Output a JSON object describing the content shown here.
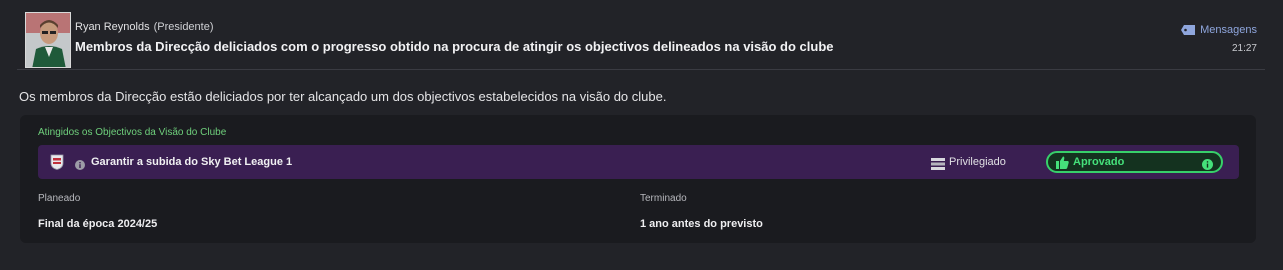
{
  "message": {
    "sender_name": "Ryan Reynolds",
    "sender_role": "(Presidente)",
    "subject": "Membros da Direcção deliciados com o progresso obtido na procura de atingir os objectivos delineados na visão do clube",
    "messages_link": "Mensagens",
    "time": "21:27",
    "body": "Os membros da Direcção estão deliciados por ter alcançado um dos objectivos estabelecidos na visão do clube."
  },
  "panel": {
    "title": "Atingidos os Objectivos da Visão do Clube",
    "objective": {
      "text": "Garantir a subida do Sky Bet League 1",
      "priority": "Privilegiado",
      "status": "Aprovado"
    },
    "planned_label": "Planeado",
    "planned_value": "Final da época 2024/25",
    "finished_label": "Terminado",
    "finished_value": "1 ano antes do previsto"
  },
  "colors": {
    "background": "#222328",
    "panel": "#1a1b1f",
    "objective_row": "#3a1f52",
    "accent_green": "#37d06a",
    "link_blue": "#8fa6dd",
    "title_green": "#6fd07c"
  },
  "icons": {
    "messages": "message-tag-icon",
    "objective_info": "info-icon",
    "priority": "priority-bars-icon",
    "status": "thumbs-up-icon",
    "status_info": "info-icon",
    "crest": "club-crest-icon"
  }
}
